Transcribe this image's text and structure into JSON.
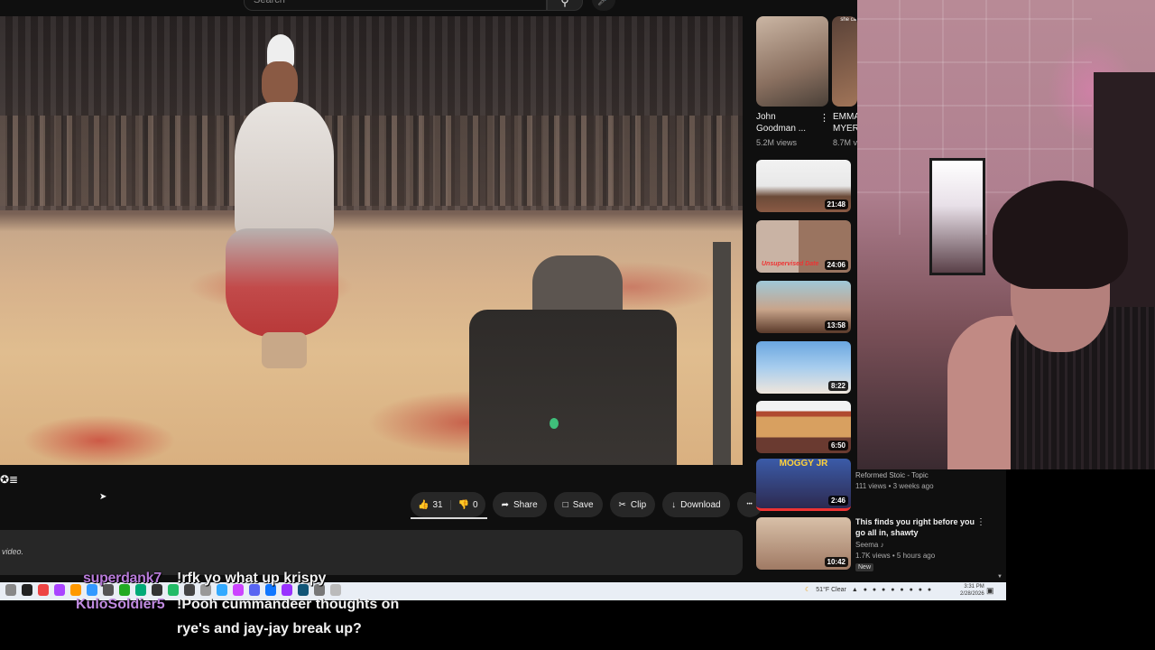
{
  "youtube": {
    "search_placeholder": "Search",
    "search_icon": "search-icon",
    "mic_icon": "mic-icon",
    "channel_glyph": "✪≣",
    "actions": {
      "like_count": "31",
      "dislike_count": "0",
      "share": "Share",
      "save": "Save",
      "clip": "Clip",
      "download": "Download",
      "more": "•••"
    },
    "description_fragment": "video."
  },
  "shorts": [
    {
      "title": "John Goodman ...",
      "views": "5.2M views"
    },
    {
      "title": "EMMA MYER",
      "views": "8.7M v",
      "badge": "she ca"
    }
  ],
  "rail_videos": [
    {
      "duration": "21:48"
    },
    {
      "duration": "24:06",
      "tag": "Unsupervised Date"
    },
    {
      "duration": "13:58"
    },
    {
      "duration": "8:22"
    },
    {
      "duration": "6:50"
    },
    {
      "duration": "2:46",
      "title_overlay": "MOGGY JR"
    },
    {
      "duration": "10:42"
    }
  ],
  "panel": {
    "channel": "Reformed Stoic - Topic",
    "meta1": "111 views • 3 weeks ago",
    "title": "This finds you right before you go all in, shawty",
    "channel2": "Seema ♪",
    "meta2": "1.7K views • 5 hours ago",
    "badge": "New"
  },
  "taskbar": {
    "weather": "51°F  Clear",
    "time": "3:31 PM",
    "date": "2/28/2026"
  },
  "chat": [
    {
      "user": "superdank7",
      "message": "!rfk yo what up krispy"
    },
    {
      "user": "KuloSoldier5",
      "message": "!Pooh cummandeer thoughts on",
      "message2": "rye's and jay-jay break up?"
    }
  ]
}
